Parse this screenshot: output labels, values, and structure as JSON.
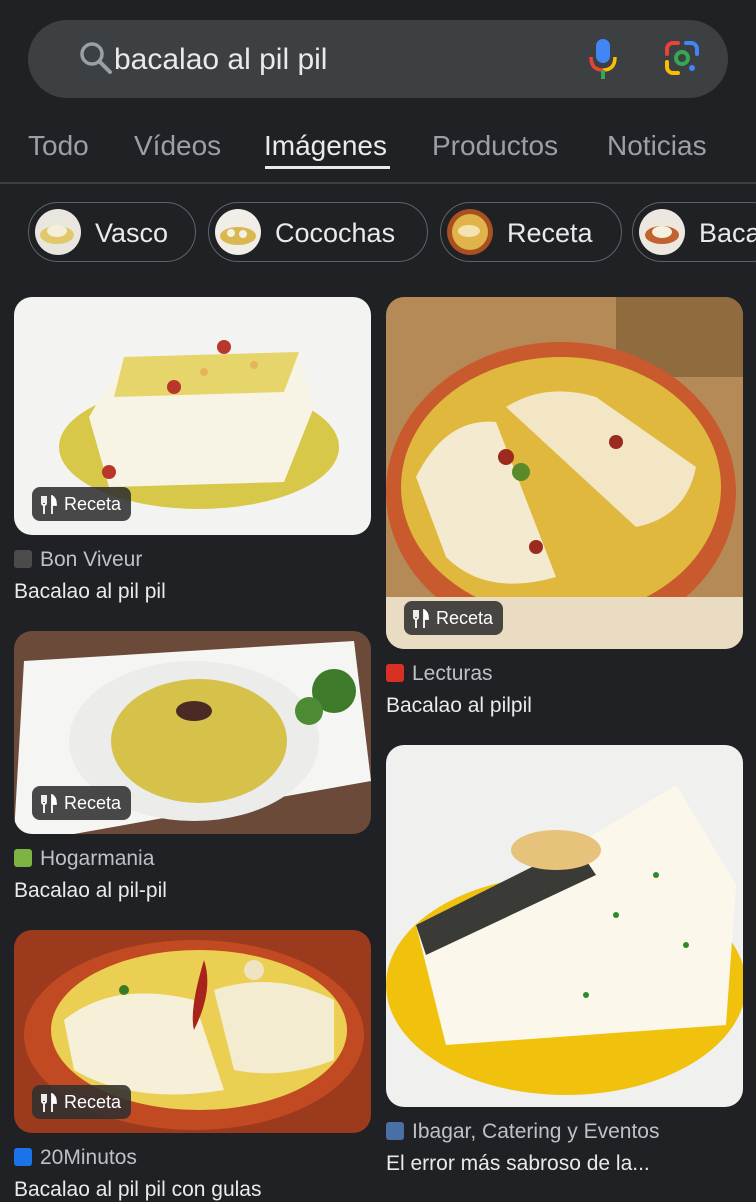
{
  "search": {
    "query": "bacalao al pil pil",
    "icons": [
      "search-icon",
      "mic-icon",
      "google-lens-icon"
    ]
  },
  "tabs": [
    {
      "label": "Todo"
    },
    {
      "label": "Vídeos"
    },
    {
      "label": "Imágenes",
      "active": true
    },
    {
      "label": "Productos"
    },
    {
      "label": "Noticias"
    }
  ],
  "chips": [
    {
      "label": "Vasco"
    },
    {
      "label": "Cocochas"
    },
    {
      "label": "Receta"
    },
    {
      "label": "Baca"
    }
  ],
  "results": [
    {
      "badge": "Receta",
      "source": "Bon Viveur",
      "title": "Bacalao al pil pil",
      "favicon": "#4b4b4b"
    },
    {
      "badge": "Receta",
      "source": "Lecturas",
      "title": "Bacalao al pilpil",
      "favicon": "#d93025"
    },
    {
      "badge": "Receta",
      "source": "Hogarmania",
      "title": "Bacalao al pil-pil",
      "favicon": "#7cb342"
    },
    {
      "badge": "Receta",
      "source": "20Minutos",
      "title": "Bacalao al pil pil con gulas",
      "favicon": "#1a73e8"
    },
    {
      "source": "Ibagar, Catering y Eventos",
      "title": "El error más sabroso de la...",
      "favicon": "#4a6fa5"
    }
  ]
}
